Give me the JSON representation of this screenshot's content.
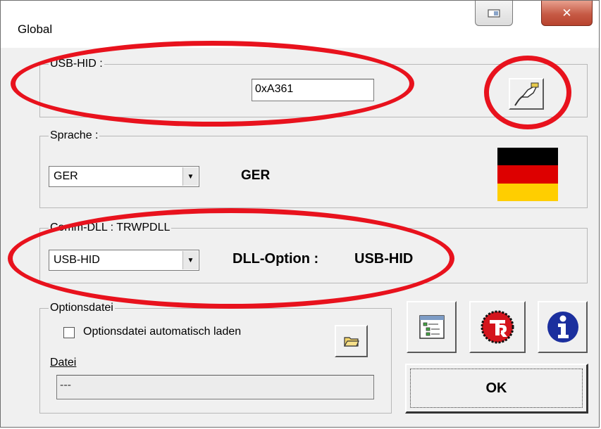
{
  "window": {
    "title": "Global"
  },
  "usb": {
    "group_label": "USB-HID :",
    "value": "0xA361"
  },
  "language": {
    "group_label": "Sprache :",
    "selected": "GER",
    "display": "GER"
  },
  "comm": {
    "group_label": "Comm-DLL : TRWPDLL",
    "selected": "USB-HID",
    "option_label": "DLL-Option :",
    "option_value": "USB-HID"
  },
  "options": {
    "group_label": "Optionsdatei",
    "checkbox_label": "Optionsdatei automatisch laden",
    "file_label": "Datei",
    "file_value": "---"
  },
  "ok_label": "OK",
  "colors": {
    "highlight_ring": "#e8121d",
    "flag_black": "#000000",
    "flag_red": "#dd0000",
    "flag_gold": "#ffce00"
  },
  "icons": [
    "usb-connector-icon",
    "folder-icon",
    "config-list-icon",
    "tr-logo-icon",
    "info-icon"
  ]
}
